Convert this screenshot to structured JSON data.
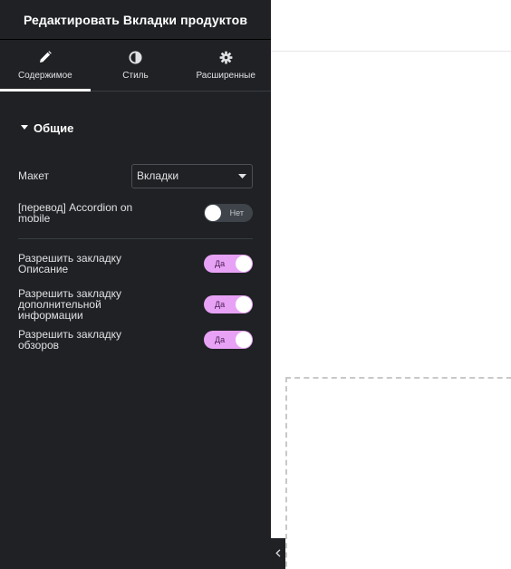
{
  "panel": {
    "title": "Редактировать Вкладки продуктов"
  },
  "tabs": [
    {
      "label": "Содержимое",
      "icon": "pencil-icon",
      "active": true
    },
    {
      "label": "Стиль",
      "icon": "half-circle-icon",
      "active": false
    },
    {
      "label": "Расширенные",
      "icon": "gear-icon",
      "active": false
    }
  ],
  "section": {
    "title": "Общие"
  },
  "controls": {
    "layout": {
      "label": "Макет",
      "value": "Вкладки"
    },
    "accordion": {
      "label_line1": "[перевод] Accordion on",
      "label_line2": "mobile",
      "state": "Нет"
    },
    "tab_description": {
      "label_line1": "Разрешить закладку",
      "label_line2": "Описание",
      "state": "Да"
    },
    "tab_additional": {
      "label_line1": "Разрешить закладку",
      "label_line2": "дополнительной",
      "label_line3": "информации",
      "state": "Да"
    },
    "tab_reviews": {
      "label_line1": "Разрешить закладку",
      "label_line2": "обзоров",
      "state": "Да"
    }
  },
  "colors": {
    "panel_bg": "#1f2124",
    "switch_on": "#e7a2f5",
    "switch_off": "#3f444b"
  }
}
